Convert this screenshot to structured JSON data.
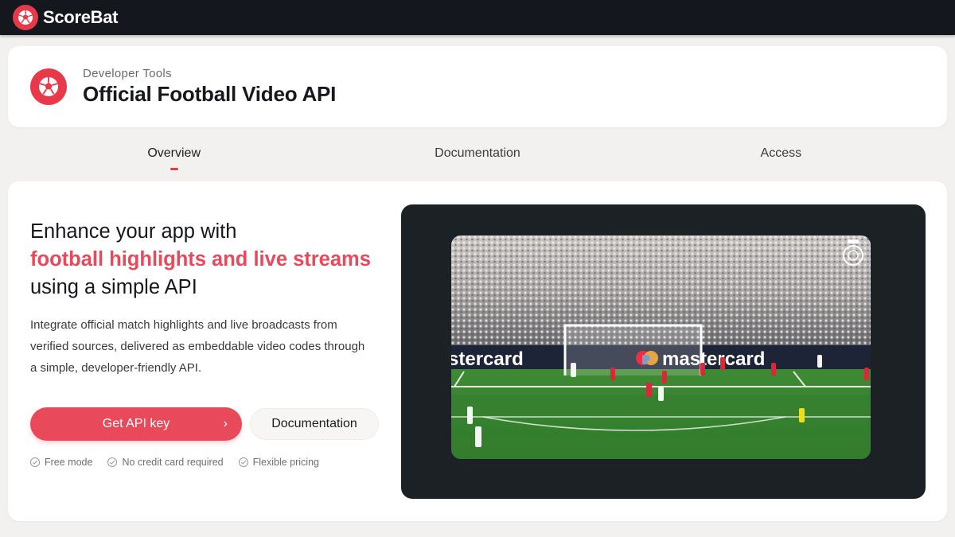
{
  "topbar": {
    "brand_name": "ScoreBat",
    "logo_icon": "soccer-ball-icon"
  },
  "header": {
    "kicker": "Developer Tools",
    "title": "Official Football Video API",
    "logo_icon": "soccer-ball-icon"
  },
  "tabs": [
    {
      "label": "Overview",
      "active": true
    },
    {
      "label": "Documentation",
      "active": false
    },
    {
      "label": "Access",
      "active": false
    }
  ],
  "hero": {
    "title_line1": "Enhance your app with",
    "title_accent": "football highlights and live streams",
    "title_line3": "using a simple API",
    "description": "Integrate official match highlights and live broadcasts from verified sources, delivered as embeddable video codes through a simple, developer-friendly API.",
    "primary_button": "Get API key",
    "primary_chevron": "›",
    "secondary_button": "Documentation",
    "features": [
      "Free mode",
      "No credit card required",
      "Flexible pricing"
    ]
  },
  "video": {
    "board_text_left": "stercard",
    "board_text_right": "mastercard"
  },
  "colors": {
    "accent": "#e84a5c",
    "topbar": "#15171f",
    "video_bg": "#1b2125"
  }
}
